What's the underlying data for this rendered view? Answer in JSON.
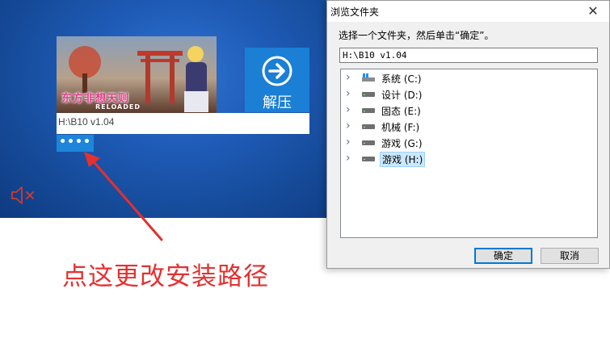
{
  "installer": {
    "game_cover": {
      "title": "东方非想天则",
      "subtitle": "RELOADED"
    },
    "extract_button_label": "解压",
    "install_path": "H:\\B10 v1.04",
    "browse_button_label": "••••"
  },
  "annotation": {
    "text": "点这更改安装路径",
    "color": "#e53030"
  },
  "dialog": {
    "title": "浏览文件夹",
    "close_glyph": "✕",
    "instruction": "选择一个文件夹，然后单击“确定”。",
    "path_value": "H:\\B10 v1.04",
    "tree_items": [
      {
        "label": "系统 (C:)",
        "icon": "windows-drive-icon",
        "selected": false
      },
      {
        "label": "设计 (D:)",
        "icon": "drive-icon",
        "selected": false
      },
      {
        "label": "固态 (E:)",
        "icon": "drive-icon",
        "selected": false
      },
      {
        "label": "机械 (F:)",
        "icon": "drive-icon",
        "selected": false
      },
      {
        "label": "游戏 (G:)",
        "icon": "drive-icon",
        "selected": false
      },
      {
        "label": "游戏 (H:)",
        "icon": "drive-icon",
        "selected": true
      }
    ],
    "ok_label": "确定",
    "cancel_label": "取消"
  },
  "colors": {
    "installer_bg": "#1f5cb8",
    "accent_blue": "#1b7fd6",
    "selection_bg": "#cce8ff",
    "mute_icon": "#d23a2c"
  }
}
